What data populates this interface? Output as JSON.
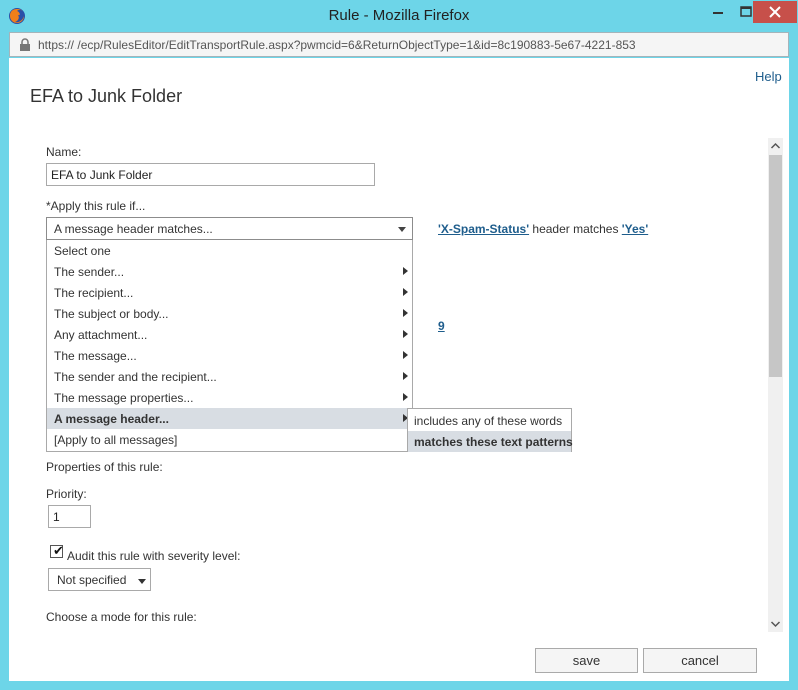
{
  "window": {
    "title": "Rule - Mozilla Firefox",
    "url_prefix": "https://",
    "url_host": "                        ",
    "url_path": "/ecp/RulesEditor/EditTransportRule.aspx?pwmcid=6&ReturnObjectType=1&id=8c190883-5e67-4221-853"
  },
  "page": {
    "help": "Help",
    "title": "EFA to Junk Folder"
  },
  "form": {
    "name_label": "Name:",
    "name_value": "EFA to Junk Folder",
    "apply_label": "*Apply this rule if...",
    "apply_selected": "A message header matches...",
    "condition": {
      "header": "'X-Spam-Status'",
      "middle": " header matches ",
      "value": "'Yes'"
    },
    "partial_link": "9",
    "menu_items": [
      {
        "label": "Select one"
      },
      {
        "label": "The sender..."
      },
      {
        "label": "The recipient..."
      },
      {
        "label": "The subject or body..."
      },
      {
        "label": "Any attachment..."
      },
      {
        "label": "The message..."
      },
      {
        "label": "The sender and the recipient..."
      },
      {
        "label": "The message properties..."
      },
      {
        "label": "A message header..."
      },
      {
        "label": "[Apply to all messages]"
      }
    ],
    "submenu_items": [
      {
        "label": "includes any of these words"
      },
      {
        "label": "matches these text patterns"
      }
    ],
    "properties_label": "Properties of this rule:",
    "priority_label": "Priority:",
    "priority_value": "1",
    "audit_label": "Audit this rule with severity level:",
    "audit_checked": true,
    "severity_value": "Not specified",
    "mode_label": "Choose a mode for this rule:"
  },
  "buttons": {
    "save": "save",
    "cancel": "cancel"
  },
  "colors": {
    "chrome": "#6dd5e8",
    "close_button": "#c7504a",
    "link": "#1e5d8c",
    "menu_highlight": "#d8dde3"
  },
  "icons": [
    "firefox-icon",
    "lock-icon",
    "minimize-icon",
    "maximize-icon",
    "close-icon",
    "chevron-right-icon",
    "chevron-down-icon",
    "checkmark-icon",
    "scroll-up-icon",
    "scroll-down-icon"
  ]
}
